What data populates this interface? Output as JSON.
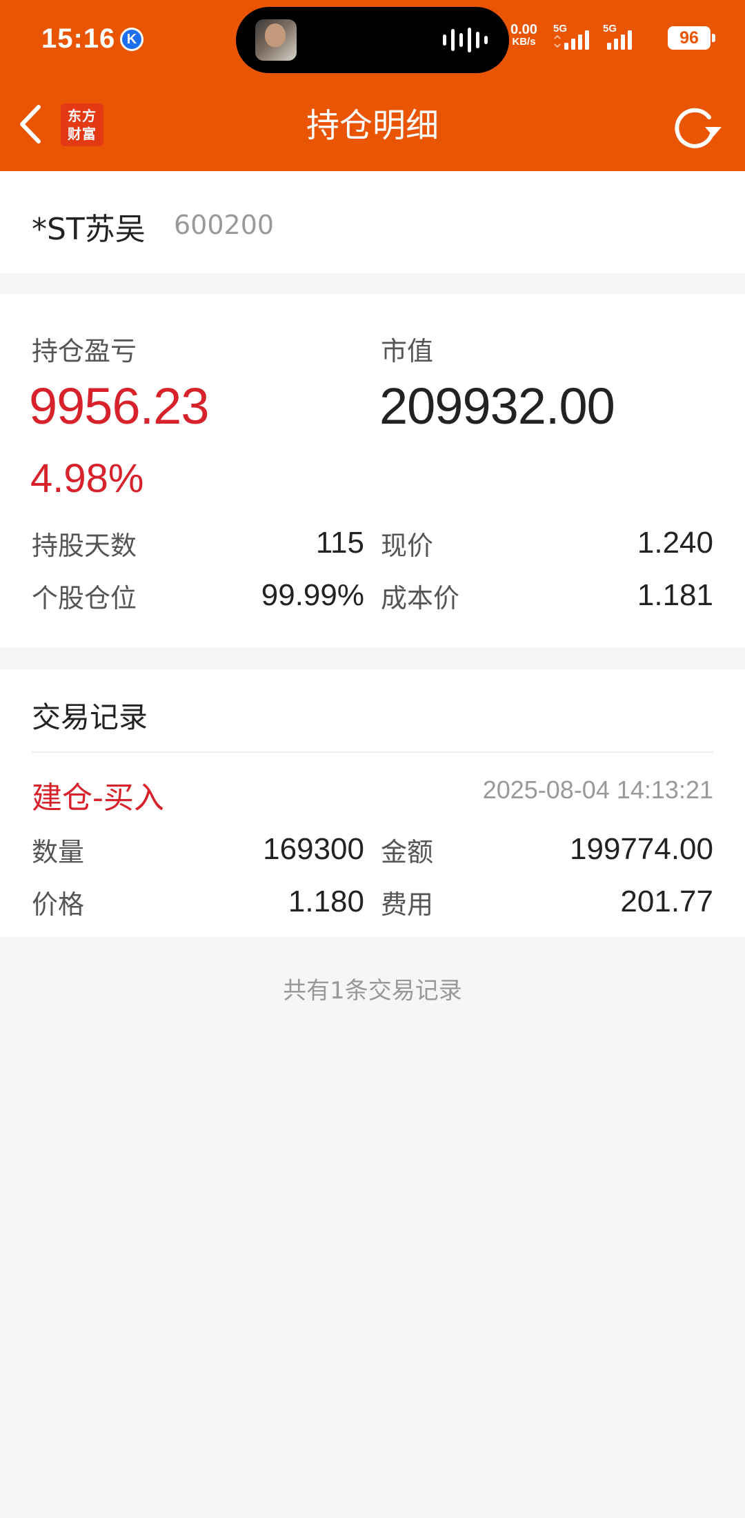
{
  "status_bar": {
    "time": "15:16",
    "app_indicator": "K",
    "net_speed_value": "0.00",
    "net_speed_unit": "KB/s",
    "sim1": "5G",
    "sim2": "5G",
    "battery": "96"
  },
  "nav": {
    "logo_line1": "东方",
    "logo_line2": "财富",
    "title": "持仓明细"
  },
  "stock": {
    "name": "*ST苏吴",
    "code": "600200"
  },
  "summary": {
    "pnl_label": "持仓盈亏",
    "pnl_value": "9956.23",
    "pnl_pct": "4.98%",
    "market_value_label": "市值",
    "market_value": "209932.00",
    "holding_days_label": "持股天数",
    "holding_days": "115",
    "current_price_label": "现价",
    "current_price": "1.240",
    "position_ratio_label": "个股仓位",
    "position_ratio": "99.99%",
    "cost_price_label": "成本价",
    "cost_price": "1.181"
  },
  "trades": {
    "section_title": "交易记录",
    "records": [
      {
        "type": "建仓-买入",
        "datetime": "2025-08-04 14:13:21",
        "quantity_label": "数量",
        "quantity": "169300",
        "amount_label": "金额",
        "amount": "199774.00",
        "price_label": "价格",
        "price": "1.180",
        "fee_label": "费用",
        "fee": "201.77"
      }
    ],
    "footer": "共有1条交易记录"
  },
  "colors": {
    "brand_orange": "#ea5504",
    "profit_red": "#d8222b"
  }
}
